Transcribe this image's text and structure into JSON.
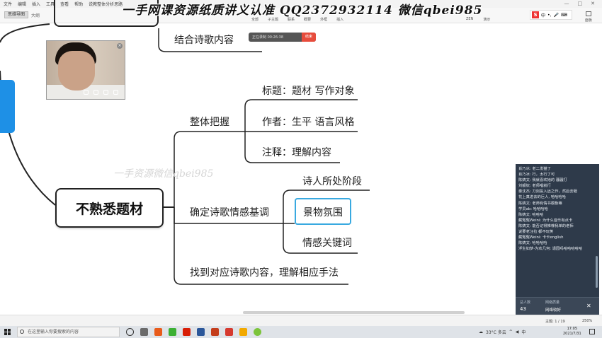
{
  "menu": [
    "文件",
    "编辑",
    "插入",
    "工具",
    "查看",
    "帮助",
    "说教整体分析思路"
  ],
  "tabs": {
    "active": "思维导图",
    "other": "大纲"
  },
  "toolbar": {
    "left_tools": [
      "全部",
      "子主题",
      "联系",
      "概要",
      "外框",
      "插入"
    ],
    "right_tools": [
      "ZEN",
      "演示"
    ],
    "ime_label": "中",
    "side_button": "面板"
  },
  "watermark_top": "一手网课资源纸质讲义认准 QQ2372932114 微信qbei985",
  "watermark_mid": "一手资源微信qbei985",
  "recording": {
    "text": "正在录制 00:26:38",
    "button": "结束"
  },
  "mindmap": {
    "central": "不熟悉题材",
    "top_partial": "结合诗歌内容",
    "branches": [
      {
        "label": "整体把握",
        "children": [
          "标题：题材 写作对象",
          "作者：生平 语言风格",
          "注释：理解内容"
        ]
      },
      {
        "label": "确定诗歌情感基调",
        "children": [
          "诗人所处阶段",
          "景物氛围",
          "情感关键词"
        ]
      },
      {
        "label": "找到对应诗歌内容，理解相应手法",
        "children": []
      }
    ]
  },
  "chat": {
    "messages": [
      "肖乃冰: 老二发猫了",
      "肖乃冰: 行，太行了可",
      "陈婧文: 我就喜欢她的 骚骚打",
      "刘靓钦: 老师唱就行",
      "秦沈杰: 刀剑投入远之作，然后去砸",
      "花上真进去的巨人, 哈哈哈哈",
      "陈婧文: 老师有情书模板嘛",
      "学员ab: 哈哈哈哈",
      "陈婧文: 哈哈哈",
      "藏冤冤Weini: 为什么音乐有点卡",
      "陈婧文: 能否记得推荐我单的老师",
      "说要老汪拉 都不玩笑",
      "藏冤冤Weini: 卡卡english",
      "陈婧文: 哈哈哈哈",
      "浮生如梦-为欢几何: 退园吗哈哈哈哈哈"
    ],
    "footer": {
      "total_label": "总人数",
      "total_value": "43",
      "network_label": "网络质量",
      "network_value": "网络较好"
    }
  },
  "status": {
    "page": "主题: 1 / 19",
    "zoom": "250%"
  },
  "taskbar": {
    "search_placeholder": "在这里输入你要搜索的内容",
    "weather": "33°C 多云",
    "ime": "中",
    "time": "17:05",
    "date": "2021/7/31"
  }
}
